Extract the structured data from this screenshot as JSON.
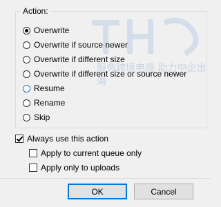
{
  "action": {
    "legend": "Action:",
    "options": [
      {
        "label": "Overwrite",
        "checked": true,
        "focused": false
      },
      {
        "label": "Overwrite if source newer",
        "checked": false,
        "focused": false
      },
      {
        "label": "Overwrite if different size",
        "checked": false,
        "focused": false
      },
      {
        "label": "Overwrite if different size or source newer",
        "checked": false,
        "focused": false
      },
      {
        "label": "Resume",
        "checked": false,
        "focused": true
      },
      {
        "label": "Rename",
        "checked": false,
        "focused": false
      },
      {
        "label": "Skip",
        "checked": false,
        "focused": false
      }
    ]
  },
  "always_use": {
    "label": "Always use this action",
    "checked": true
  },
  "sub_options": [
    {
      "label": "Apply to current queue only",
      "checked": false
    },
    {
      "label": "Apply only to uploads",
      "checked": false
    }
  ],
  "buttons": {
    "ok": "OK",
    "cancel": "Cancel"
  },
  "watermark": {
    "text": "服务跨境电商 助力中企出海"
  },
  "colors": {
    "accent": "#0078d7",
    "focus_radio": "#1a73c9",
    "background": "#f0f0f0"
  }
}
